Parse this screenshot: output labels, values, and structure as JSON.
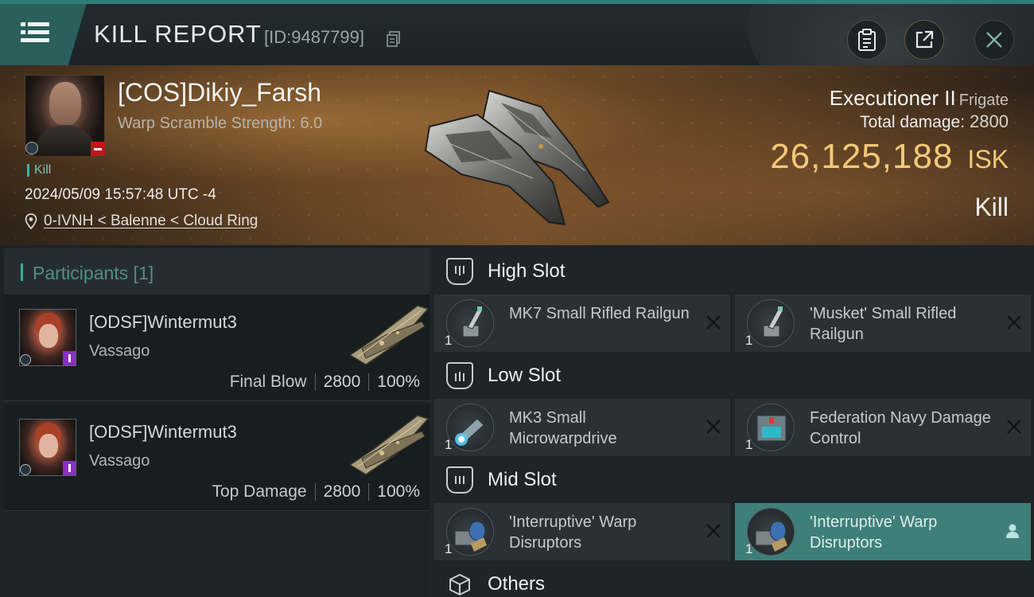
{
  "header": {
    "title": "KILL REPORT",
    "report_id": "[ID:9487799]"
  },
  "victim": {
    "name": "[COS]Dikiy_Farsh",
    "stat": "Warp Scramble Strength: 6.0",
    "kill_tag": "Kill",
    "timestamp": "2024/05/09 15:57:48 UTC -4",
    "location": "0-IVNH < Balenne < Cloud Ring",
    "ship_name": "Executioner II",
    "ship_type": "Frigate",
    "total_damage_label": "Total damage:",
    "total_damage": "2800",
    "isk_value": "26,125,188",
    "isk_unit": "ISK",
    "result": "Kill",
    "isk_color": "#f4c979"
  },
  "participants": {
    "header": "Participants [1]",
    "rows": [
      {
        "name": "[ODSF]Wintermut3",
        "ship": "Vassago",
        "label": "Final Blow",
        "damage": "2800",
        "percent": "100%"
      },
      {
        "name": "[ODSF]Wintermut3",
        "ship": "Vassago",
        "label": "Top Damage",
        "damage": "2800",
        "percent": "100%"
      }
    ]
  },
  "fitting": {
    "high_slot": {
      "title": "High Slot",
      "modules": [
        {
          "name": "MK7 Small Rifled Railgun",
          "qty": "1",
          "icon": "railgun-icon"
        },
        {
          "name": "'Musket' Small Rifled Railgun",
          "qty": "1",
          "icon": "railgun-icon"
        }
      ]
    },
    "low_slot": {
      "title": "Low Slot",
      "modules": [
        {
          "name": "MK3 Small Microwarpdrive",
          "qty": "1",
          "icon": "microwarpdrive-icon"
        },
        {
          "name": "Federation Navy Damage Control",
          "qty": "1",
          "icon": "damage-control-icon"
        }
      ]
    },
    "mid_slot": {
      "title": "Mid Slot",
      "modules": [
        {
          "name": "'Interruptive' Warp Disruptors",
          "qty": "1",
          "icon": "warp-disruptor-icon"
        },
        {
          "name": "'Interruptive' Warp Disruptors",
          "qty": "1",
          "icon": "warp-disruptor-icon"
        }
      ]
    },
    "others": {
      "title": "Others"
    }
  },
  "accent_color": "#3aa99c"
}
